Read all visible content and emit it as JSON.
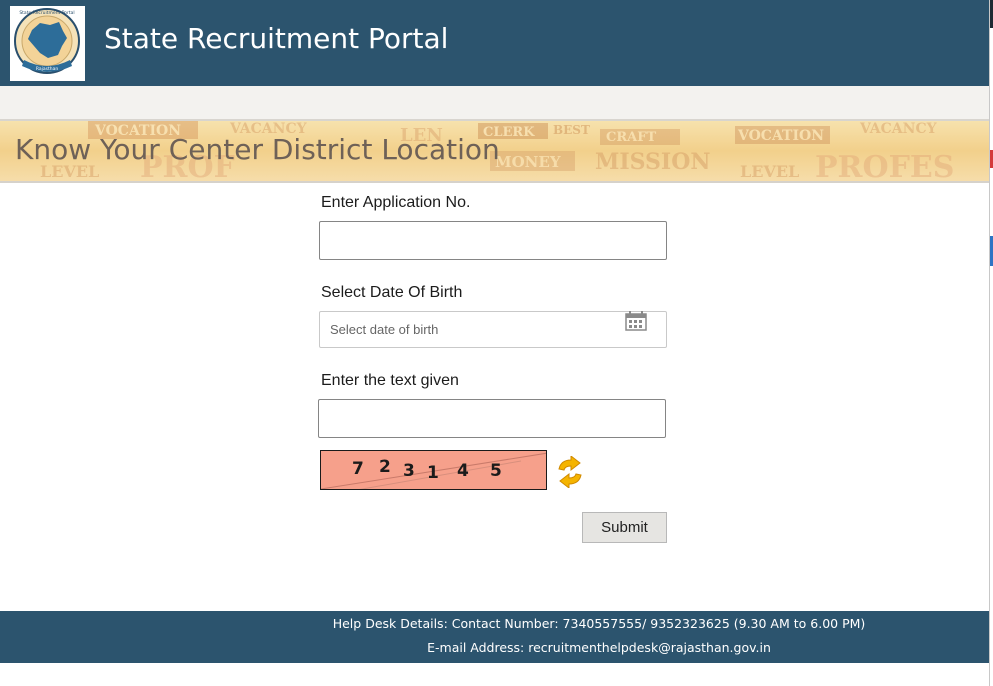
{
  "header": {
    "title": "State Recruitment Portal",
    "logo": {
      "top_text": "State Recruitment Portal",
      "bottom_text": "Rajasthan"
    }
  },
  "banner": {
    "heading": "Know Your Center District Location"
  },
  "form": {
    "application_no": {
      "label": "Enter Application No.",
      "value": "",
      "placeholder": ""
    },
    "dob": {
      "label": "Select Date Of Birth",
      "value": "",
      "placeholder": "Select date of birth"
    },
    "captcha_text": {
      "label": "Enter the text given",
      "value": "",
      "placeholder": ""
    },
    "captcha": {
      "digits": [
        "7",
        "2",
        "3",
        "1",
        "4",
        "5"
      ]
    },
    "submit_label": "Submit"
  },
  "footer": {
    "helpdesk": "Help Desk Details: Contact Number: 7340557555/ 9352323625 (9.30 AM to 6.00 PM)",
    "email": "E-mail Address: recruitmenthelpdesk@rajasthan.gov.in"
  },
  "colors": {
    "header_bg": "#2c546e",
    "banner_bg": "#f2d08b",
    "captcha_bg": "#f6a08b"
  },
  "icons": [
    "rajasthan-map-logo",
    "calendar-icon",
    "refresh-icon"
  ]
}
